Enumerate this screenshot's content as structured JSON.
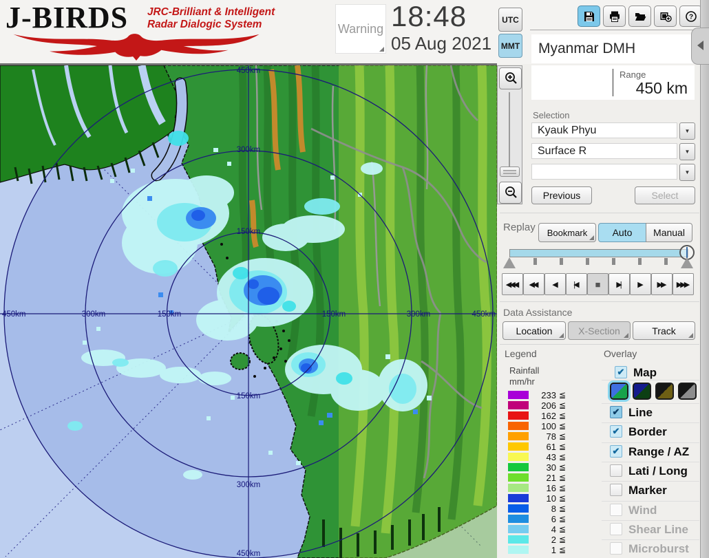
{
  "app": {
    "title": "J-BIRDS",
    "subtitle1": "JRC-Brilliant & Intelligent",
    "subtitle2": "Radar  Dialogic  System"
  },
  "header": {
    "warning": "Warning",
    "time": "18:48",
    "date": "05 Aug 2021",
    "utc": "UTC",
    "mmt": "MMT",
    "station": "Myanmar DMH",
    "toolbar_icons": [
      "save-icon",
      "print-icon",
      "open-folder-icon",
      "capture-icon",
      "help-icon"
    ]
  },
  "range": {
    "label": "Range",
    "value": "450 km"
  },
  "selection": {
    "label": "Selection",
    "site": "Kyauk Phyu",
    "product": "Surface R",
    "extra": "",
    "previous": "Previous",
    "select": "Select"
  },
  "replay": {
    "label": "Replay",
    "bookmark": "Bookmark",
    "auto": "Auto",
    "manual": "Manual",
    "mode": "Auto",
    "controls": [
      {
        "name": "rewind-fast",
        "glyph": "◀◀◀"
      },
      {
        "name": "rewind",
        "glyph": "◀◀"
      },
      {
        "name": "play-reverse",
        "glyph": "◀"
      },
      {
        "name": "step-back",
        "glyph": "|◀"
      },
      {
        "name": "stop",
        "glyph": "■"
      },
      {
        "name": "step-forward",
        "glyph": "▶|"
      },
      {
        "name": "play",
        "glyph": "▶"
      },
      {
        "name": "forward",
        "glyph": "▶▶"
      },
      {
        "name": "forward-fast",
        "glyph": "▶▶▶"
      }
    ]
  },
  "data_assistance": {
    "label": "Data Assistance",
    "location": "Location",
    "xsection": "X-Section",
    "track": "Track"
  },
  "legend": {
    "label": "Legend",
    "unit1": "Rainfall",
    "unit2": "mm/hr",
    "suffix": "≦",
    "entries": [
      {
        "value": "233",
        "color": "#a800d8"
      },
      {
        "value": "206",
        "color": "#c0007a"
      },
      {
        "value": "162",
        "color": "#e81414"
      },
      {
        "value": "100",
        "color": "#f86400"
      },
      {
        "value": "78",
        "color": "#ffa000"
      },
      {
        "value": "61",
        "color": "#fec800"
      },
      {
        "value": "43",
        "color": "#f8f852"
      },
      {
        "value": "30",
        "color": "#16c83c"
      },
      {
        "value": "21",
        "color": "#6ede2c"
      },
      {
        "value": "16",
        "color": "#a6e882"
      },
      {
        "value": "10",
        "color": "#1a3cd8"
      },
      {
        "value": "8",
        "color": "#085ee8"
      },
      {
        "value": "6",
        "color": "#1e8ee0"
      },
      {
        "value": "4",
        "color": "#76ccf0"
      },
      {
        "value": "2",
        "color": "#5ce8e8"
      },
      {
        "value": "1",
        "color": "#aff6f2"
      }
    ]
  },
  "overlay": {
    "label": "Overlay",
    "check_glyph": "✔",
    "items": [
      {
        "label": "Map",
        "state": "checked"
      },
      {
        "label": "Line",
        "state": "checked-active"
      },
      {
        "label": "Border",
        "state": "checked"
      },
      {
        "label": "Range / AZ",
        "state": "checked"
      },
      {
        "label": "Lati / Long",
        "state": "unchecked"
      },
      {
        "label": "Marker",
        "state": "unchecked"
      },
      {
        "label": "Wind",
        "state": "disabled"
      },
      {
        "label": "Shear Line",
        "state": "disabled"
      },
      {
        "label": "Microburst",
        "state": "disabled"
      }
    ],
    "map_styles": [
      {
        "c1": "#3f6fe0",
        "c2": "#17a34a",
        "selected": true
      },
      {
        "c1": "#141a8c",
        "c2": "#0c3f14",
        "selected": false
      },
      {
        "c1": "#151515",
        "c2": "#6e5f14",
        "selected": false
      },
      {
        "c1": "#151515",
        "c2": "#8d8d8d",
        "selected": false
      }
    ]
  },
  "map": {
    "labels_vertical": [
      "450km",
      "300km",
      "150km",
      "150km",
      "300km",
      "450km"
    ],
    "labels_horizontal": [
      "450km",
      "300km",
      "150km",
      "150km",
      "300km",
      "450km"
    ],
    "zoom_icons": [
      "zoom-in-icon",
      "zoom-out-icon"
    ]
  }
}
